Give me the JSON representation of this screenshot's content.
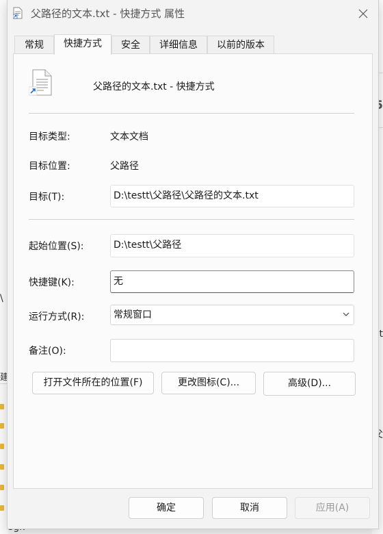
{
  "window": {
    "title": "父路径的文本.txt - 快捷方式 属性",
    "close_icon": "close-icon"
  },
  "tabs": [
    {
      "label": "常规"
    },
    {
      "label": "快捷方式",
      "active": true
    },
    {
      "label": "安全"
    },
    {
      "label": "详细信息"
    },
    {
      "label": "以前的版本"
    }
  ],
  "shortcut": {
    "name": "父路径的文本.txt - 快捷方式",
    "target_type_label": "目标类型:",
    "target_type": "文本文档",
    "target_location_label": "目标位置:",
    "target_location": "父路径",
    "target_label": "目标(T):",
    "target": "D:\\testt\\父路径\\父路径的文本.txt",
    "start_in_label": "起始位置(S):",
    "start_in": "D:\\testt\\父路径",
    "shortcut_key_label": "快捷键(K):",
    "shortcut_key": "无",
    "run_label": "运行方式(R):",
    "run": "常规窗口",
    "comment_label": "备注(O):",
    "comment": ""
  },
  "actions": {
    "open_location": "打开文件所在的位置(F)",
    "change_icon": "更改图标(C)...",
    "advanced": "高级(D)..."
  },
  "footer": {
    "ok": "确定",
    "cancel": "取消",
    "apply": "应用(A)"
  },
  "background": {
    "right_fragment_1": "5",
    "right_fragment_2": "st",
    "right_fragment_3": "父",
    "left_fragment_1": "\\",
    "left_fragment_2": "建",
    "bottom_fragment": "sgk"
  }
}
